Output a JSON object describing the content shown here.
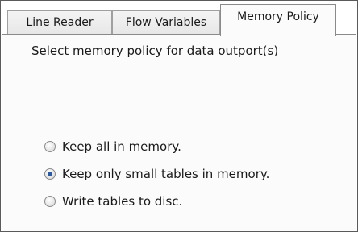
{
  "tabs": [
    {
      "label": "Line Reader",
      "active": false
    },
    {
      "label": "Flow Variables",
      "active": false
    },
    {
      "label": "Memory Policy",
      "active": true
    }
  ],
  "panel": {
    "instruction": "Select memory policy for data outport(s)",
    "options": [
      {
        "label": "Keep all in memory.",
        "selected": false
      },
      {
        "label": "Keep only small tables in memory.",
        "selected": true
      },
      {
        "label": "Write tables to disc.",
        "selected": false
      }
    ]
  },
  "colors": {
    "radio_selected": "#2c5aa0",
    "panel_background": "#fbfbfb"
  }
}
